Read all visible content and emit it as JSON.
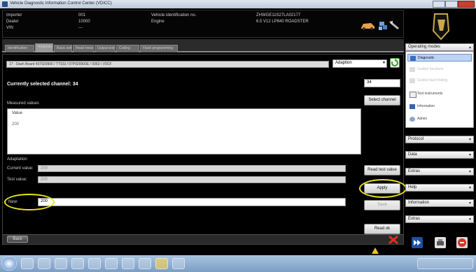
{
  "window": {
    "title": "Vehicle Diagnostic Information Control Center (VDICC)"
  },
  "header": {
    "left": [
      {
        "label": "Importer",
        "value": "001"
      },
      {
        "label": "Dealer",
        "value": "10000"
      },
      {
        "label": "VIN",
        "value": "---"
      }
    ],
    "vehicle_id_label": "Vehicle identification no.",
    "vehicle_id_value": "ZHWGE11S27LA02177",
    "engine_label": "Engine",
    "engine_value": "6.5 V12 LP640 ROADSTER"
  },
  "tabs": [
    "Identification",
    "Adaptation",
    "Basic setting",
    "Read measured values",
    "Output test",
    "Coding",
    "Flash programming"
  ],
  "control_unit_select": "17 - Dash Board 407920900 / TTSSI / 07P920900E / 0063 / V0CF",
  "mode_select": "Adaption",
  "current_channel": "Currently selected channel: 34",
  "channel_input": "34",
  "buttons": {
    "select_channel": "Select channel",
    "read_test_value": "Read test value",
    "apply": "Apply",
    "save": "Save",
    "read_ok": "Read ok",
    "bottom_left": "Back"
  },
  "measured_values": {
    "label": "Measured values",
    "column": "Value",
    "value": "200"
  },
  "adaptation": {
    "label": "Adaptation",
    "current_label": "Current value:",
    "current_value": "200",
    "test_label": "Test value:",
    "test_value": "200",
    "new_label": "New:",
    "new_value": "200"
  },
  "right": {
    "operating_modes": "Operating modes",
    "items": [
      "Diagnostic",
      "Guided functions",
      "Guided fault finding",
      "Test instruments",
      "Information",
      "Admin"
    ],
    "menus": [
      "Protocol",
      "Data",
      "Extras",
      "Help",
      "Information",
      "Extras"
    ]
  },
  "colors": {
    "background": "#000000",
    "highlight": "#e8e41f",
    "close": "#d9342a"
  }
}
